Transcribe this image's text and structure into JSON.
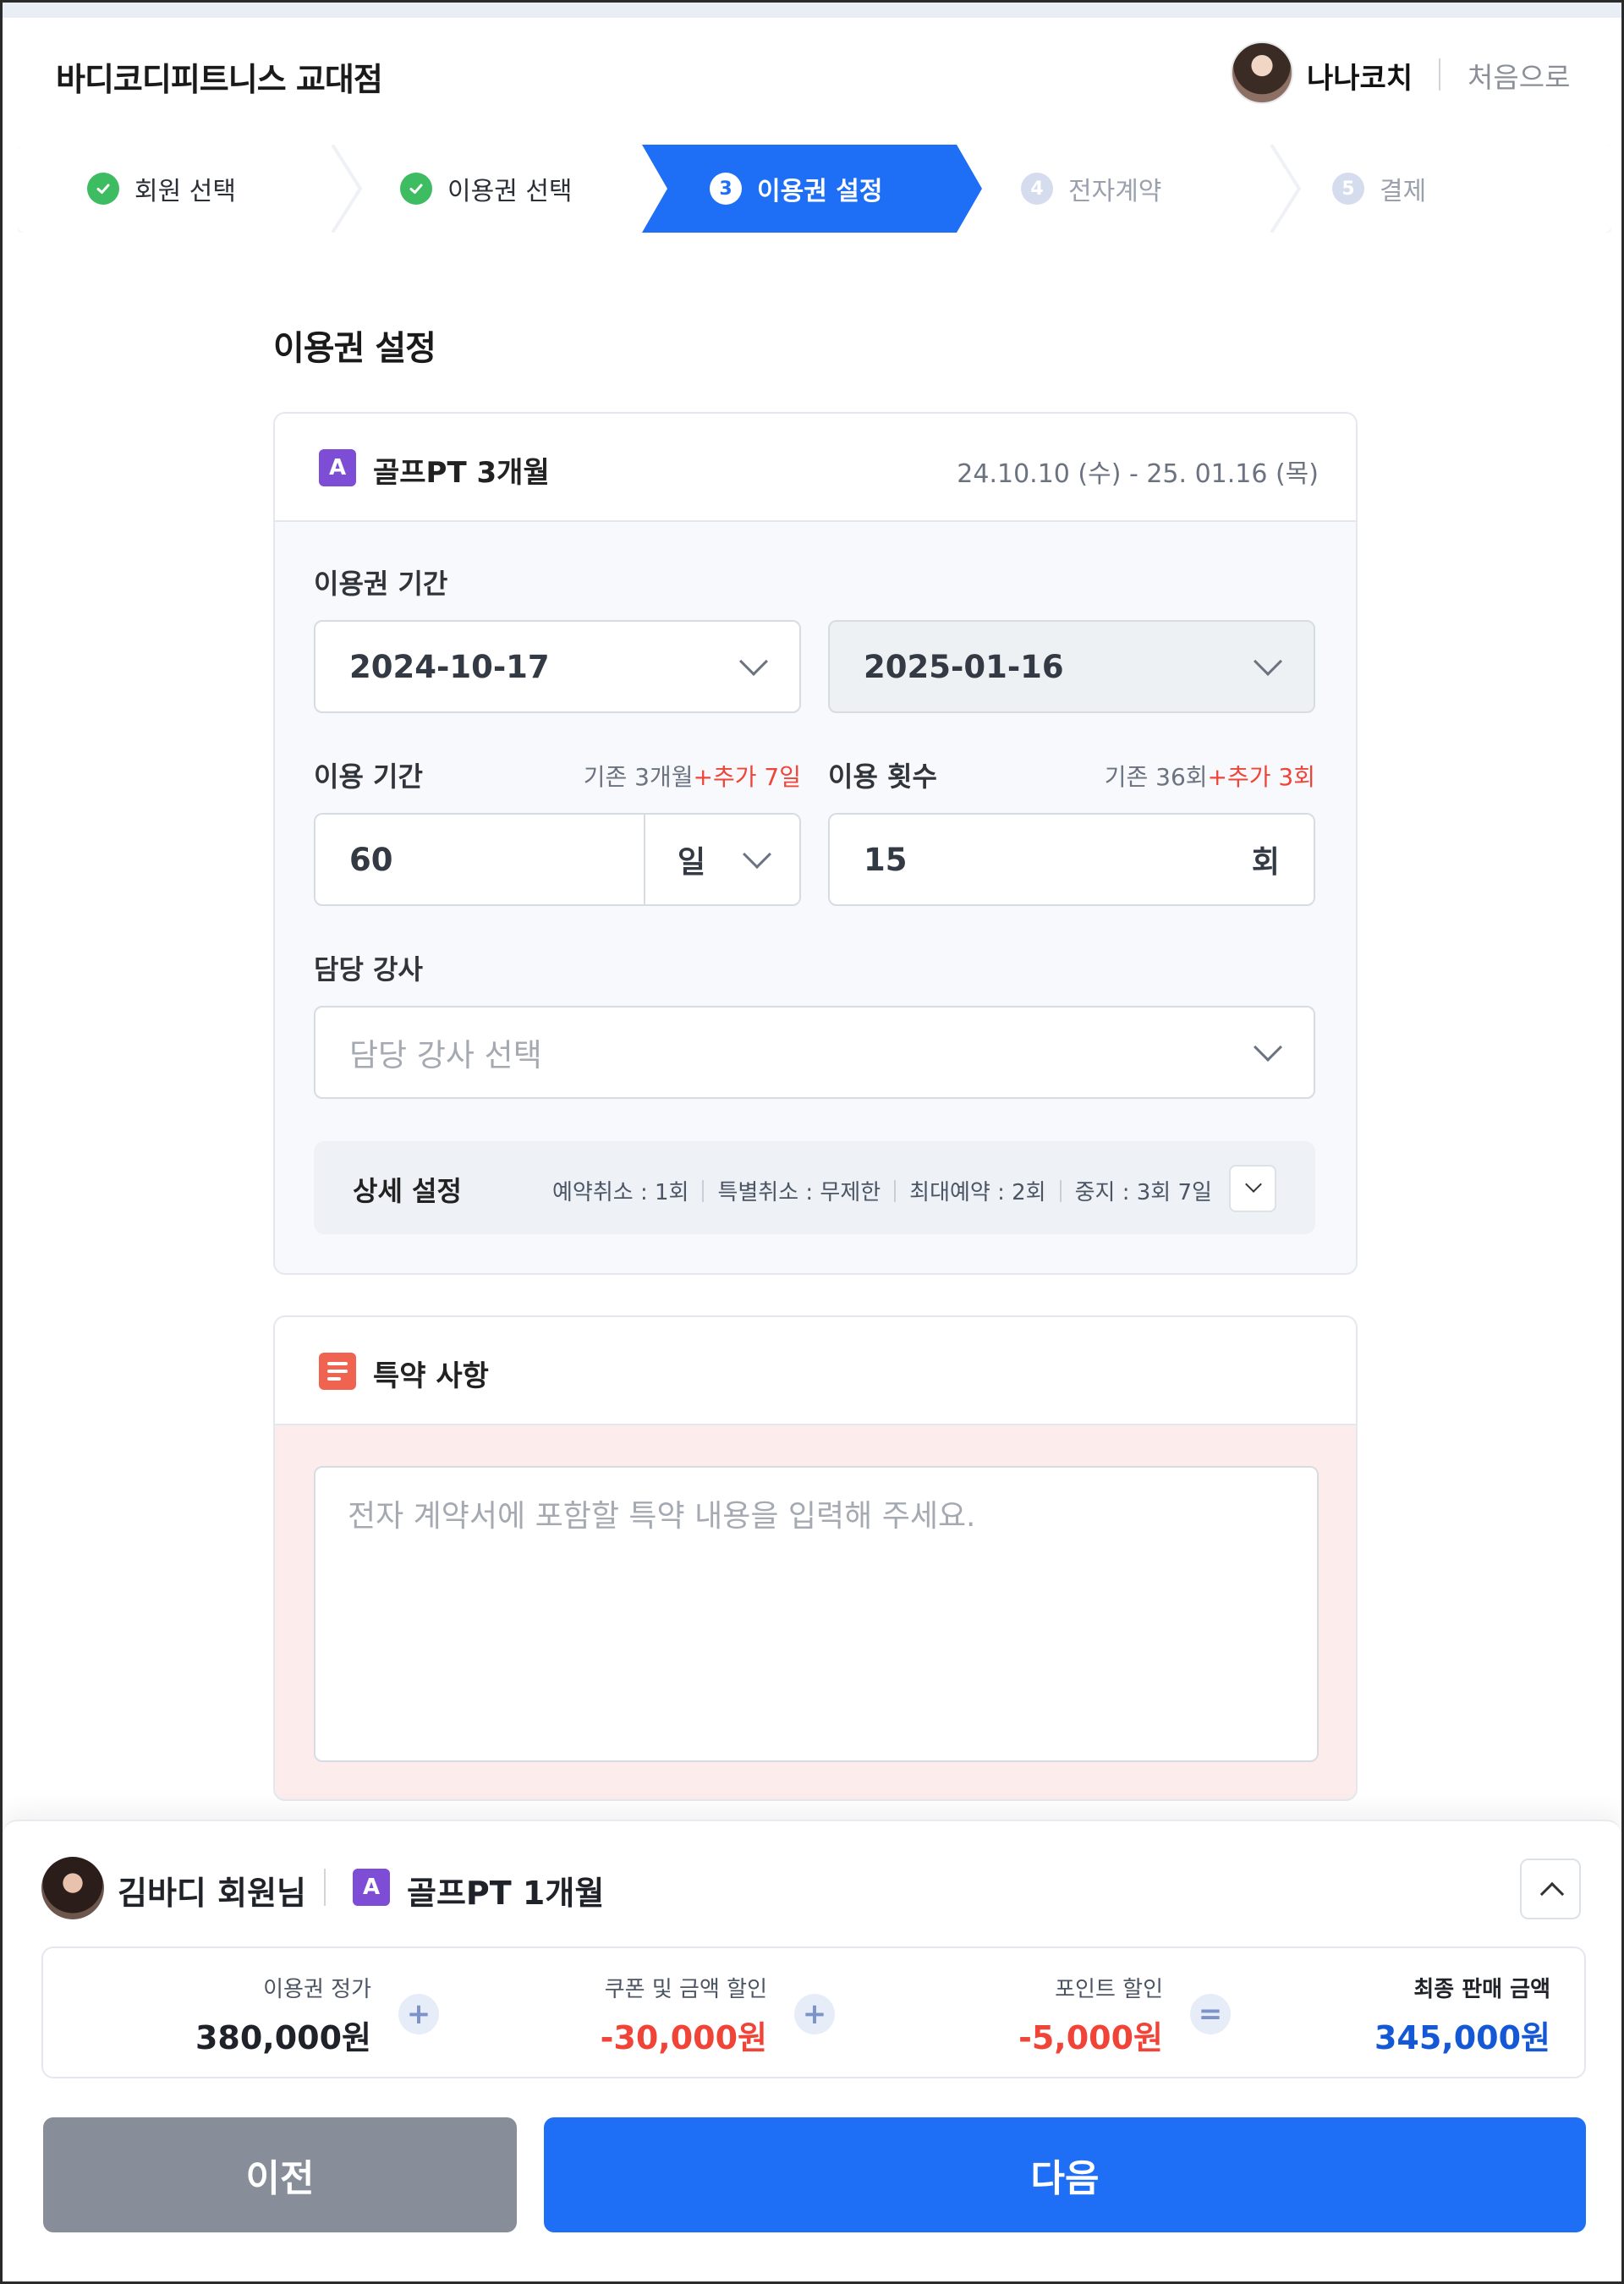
{
  "header": {
    "brand": "바디코디피트니스 교대점",
    "coach_name": "나나코치",
    "home_link": "처음으로"
  },
  "steps": [
    {
      "number": "1",
      "label": "회원 선택",
      "state": "done"
    },
    {
      "number": "2",
      "label": "이용권 선택",
      "state": "done"
    },
    {
      "number": "3",
      "label": "이용권 설정",
      "state": "current"
    },
    {
      "number": "4",
      "label": "전자계약",
      "state": "todo"
    },
    {
      "number": "5",
      "label": "결제",
      "state": "todo"
    }
  ],
  "page_title": "이용권 설정",
  "ticket": {
    "badge": "A",
    "name": "골프PT 3개월",
    "range": "24.10.10 (수) - 25. 01.16 (목)"
  },
  "period": {
    "label": "이용권 기간",
    "start": "2024-10-17",
    "end": "2025-01-16"
  },
  "duration": {
    "label": "이용 기간",
    "base_note": "기존 3개월",
    "extra_note": "+추가 7일",
    "value": "60",
    "unit": "일"
  },
  "count": {
    "label": "이용 횟수",
    "base_note": "기존 36회",
    "extra_note": "+추가 3회",
    "value": "15",
    "unit": "회"
  },
  "instructor": {
    "label": "담당 강사",
    "placeholder": "담당 강사 선택"
  },
  "detail": {
    "title": "상세 설정",
    "items": [
      "예약취소 : 1회",
      "특별취소 : 무제한",
      "최대예약 : 2회",
      "중지 : 3회 7일"
    ]
  },
  "special_terms": {
    "title": "특약 사항",
    "placeholder": "전자 계약서에 포함할 특약 내용을 입력해 주세요."
  },
  "summary": {
    "member": "김바디 회원님",
    "badge": "A",
    "ticket": "골프PT 1개월",
    "list_price_label": "이용권 정가",
    "list_price": "380,000원",
    "coupon_label": "쿠폰 및 금액 할인",
    "coupon": "-30,000원",
    "point_label": "포인트 할인",
    "point": "-5,000원",
    "final_label": "최종 판매 금액",
    "final": "345,000원",
    "op_plus": "+",
    "op_equals": "="
  },
  "buttons": {
    "prev": "이전",
    "next": "다음"
  },
  "colors": {
    "primary": "#1e6ff5",
    "done": "#3ebc62",
    "discount": "#f04438",
    "final": "#1558d6",
    "badge": "#7d4dd6"
  }
}
